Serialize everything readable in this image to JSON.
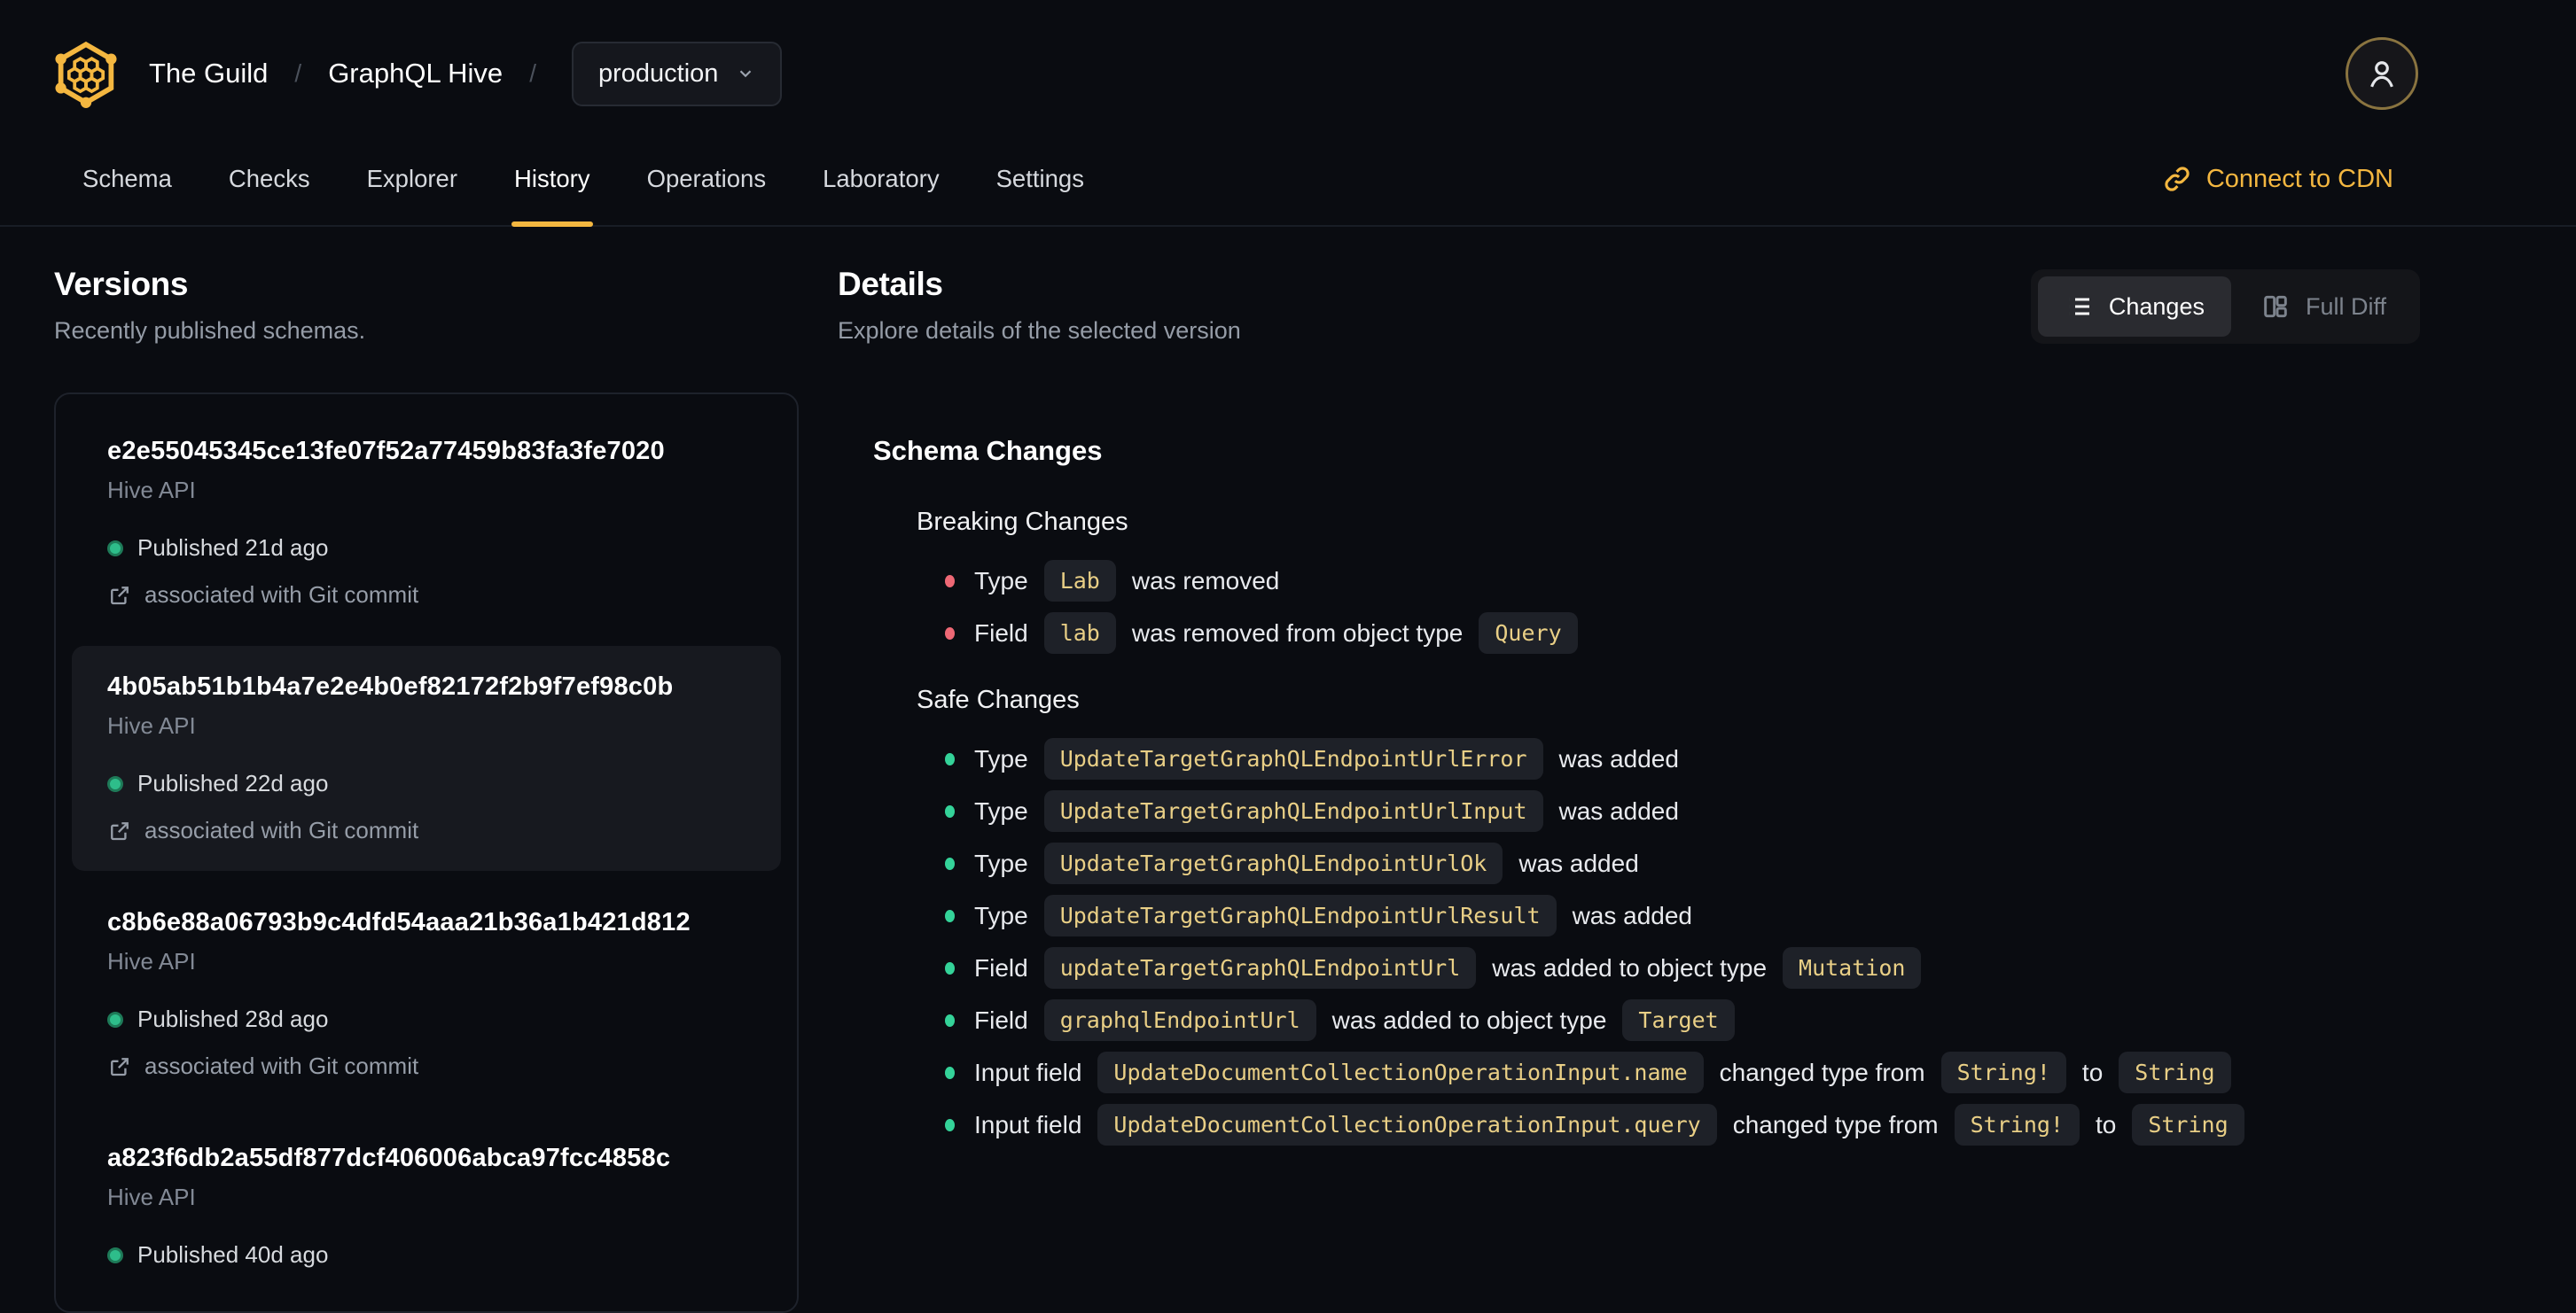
{
  "colors": {
    "accent": "#f4b740",
    "breaking": "#ee6875",
    "safe": "#34d399",
    "published": "#2ebd8a"
  },
  "header": {
    "org": "The Guild",
    "separator": "/",
    "project": "GraphQL Hive",
    "target_selector": {
      "value": "production"
    },
    "tabs": [
      {
        "label": "Schema",
        "active": false
      },
      {
        "label": "Checks",
        "active": false
      },
      {
        "label": "Explorer",
        "active": false
      },
      {
        "label": "History",
        "active": true
      },
      {
        "label": "Operations",
        "active": false
      },
      {
        "label": "Laboratory",
        "active": false
      },
      {
        "label": "Settings",
        "active": false
      }
    ],
    "cdn_link_label": "Connect to CDN"
  },
  "versions": {
    "title": "Versions",
    "subtitle": "Recently published schemas.",
    "items": [
      {
        "hash": "e2e55045345ce13fe07f52a77459b83fa3fe7020",
        "service": "Hive API",
        "status": "Published 21d ago",
        "git": "associated with Git commit",
        "selected": false
      },
      {
        "hash": "4b05ab51b1b4a7e2e4b0ef82172f2b9f7ef98c0b",
        "service": "Hive API",
        "status": "Published 22d ago",
        "git": "associated with Git commit",
        "selected": true
      },
      {
        "hash": "c8b6e88a06793b9c4dfd54aaa21b36a1b421d812",
        "service": "Hive API",
        "status": "Published 28d ago",
        "git": "associated with Git commit",
        "selected": false
      },
      {
        "hash": "a823f6db2a55df877dcf406006abca97fcc4858c",
        "service": "Hive API",
        "status": "Published 40d ago",
        "git": null,
        "selected": false
      }
    ]
  },
  "details": {
    "title": "Details",
    "subtitle": "Explore details of the selected version",
    "view_toggle": [
      {
        "label": "Changes",
        "icon": "list-icon",
        "active": true
      },
      {
        "label": "Full Diff",
        "icon": "columns-icon",
        "active": false
      }
    ],
    "schema_changes": {
      "title": "Schema Changes",
      "groups": [
        {
          "title": "Breaking Changes",
          "severity": "breaking",
          "items": [
            [
              {
                "text": "Type"
              },
              {
                "code": "Lab"
              },
              {
                "text": "was removed"
              }
            ],
            [
              {
                "text": "Field"
              },
              {
                "code": "lab"
              },
              {
                "text": "was removed from object type"
              },
              {
                "code": "Query"
              }
            ]
          ]
        },
        {
          "title": "Safe Changes",
          "severity": "safe",
          "items": [
            [
              {
                "text": "Type"
              },
              {
                "code": "UpdateTargetGraphQLEndpointUrlError"
              },
              {
                "text": "was added"
              }
            ],
            [
              {
                "text": "Type"
              },
              {
                "code": "UpdateTargetGraphQLEndpointUrlInput"
              },
              {
                "text": "was added"
              }
            ],
            [
              {
                "text": "Type"
              },
              {
                "code": "UpdateTargetGraphQLEndpointUrlOk"
              },
              {
                "text": "was added"
              }
            ],
            [
              {
                "text": "Type"
              },
              {
                "code": "UpdateTargetGraphQLEndpointUrlResult"
              },
              {
                "text": "was added"
              }
            ],
            [
              {
                "text": "Field"
              },
              {
                "code": "updateTargetGraphQLEndpointUrl"
              },
              {
                "text": "was added to object type"
              },
              {
                "code": "Mutation"
              }
            ],
            [
              {
                "text": "Field"
              },
              {
                "code": "graphqlEndpointUrl"
              },
              {
                "text": "was added to object type"
              },
              {
                "code": "Target"
              }
            ],
            [
              {
                "text": "Input field"
              },
              {
                "code": "UpdateDocumentCollectionOperationInput.name"
              },
              {
                "text": "changed type from"
              },
              {
                "code": "String!"
              },
              {
                "text": "to"
              },
              {
                "code": "String"
              }
            ],
            [
              {
                "text": "Input field"
              },
              {
                "code": "UpdateDocumentCollectionOperationInput.query"
              },
              {
                "text": "changed type from"
              },
              {
                "code": "String!"
              },
              {
                "text": "to"
              },
              {
                "code": "String"
              }
            ]
          ]
        }
      ]
    }
  }
}
